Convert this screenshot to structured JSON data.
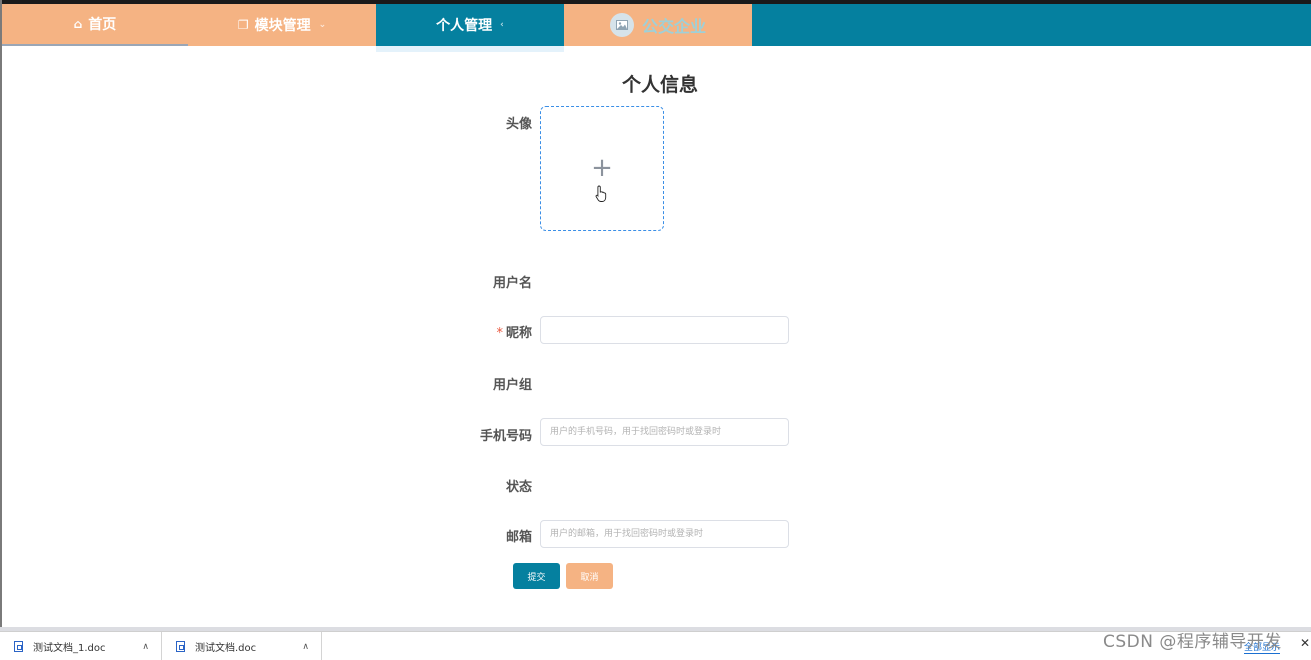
{
  "nav": {
    "home_label": "首页",
    "module_label": "模块管理",
    "personal_label": "个人管理",
    "company_label": "公交企业"
  },
  "form": {
    "title": "个人信息",
    "avatar_label": "头像",
    "upload_plus": "+",
    "username_label": "用户名",
    "nickname_required_mark": "*",
    "nickname_label": "昵称",
    "nickname_value": "",
    "usergroup_label": "用户组",
    "phone_label": "手机号码",
    "phone_placeholder": "用户的手机号码，用于找回密码时或登录时",
    "status_label": "状态",
    "email_label": "邮箱",
    "email_placeholder": "用户的邮箱，用于找回密码时或登录时",
    "submit_label": "提交",
    "cancel_label": "取消"
  },
  "downloads": {
    "items": [
      {
        "name": "测试文档_1.doc"
      },
      {
        "name": "测试文档.doc"
      }
    ],
    "show_all": "全部显示",
    "close": "✕"
  },
  "watermark": "CSDN @程序辅导开发",
  "colors": {
    "primary": "#05809f",
    "accent": "#f5b383",
    "upload_border": "#3a8ee6",
    "required": "#e9573f"
  }
}
